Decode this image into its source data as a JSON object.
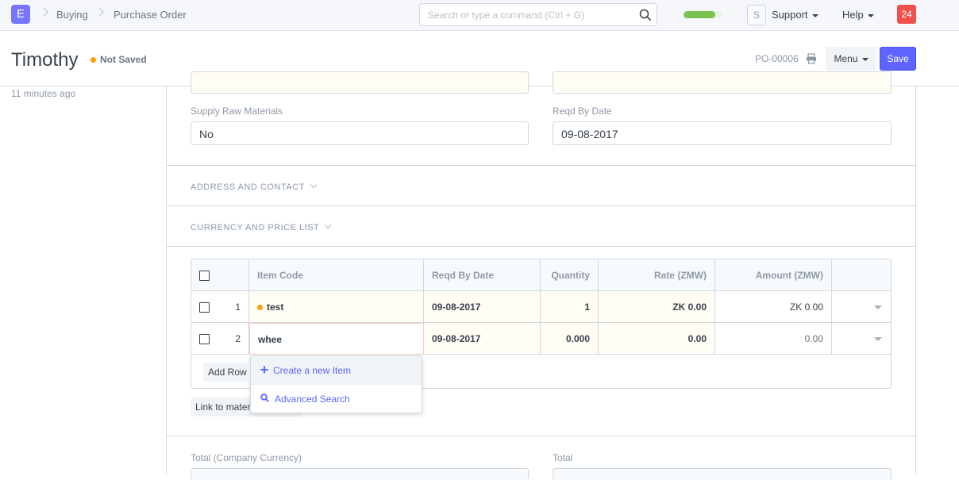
{
  "navbar": {
    "logo": "E",
    "breadcrumbs": [
      "Buying",
      "Purchase Order"
    ],
    "search_placeholder": "Search or type a command (Ctrl + G)",
    "progress_percent": 80,
    "avatar_initial": "S",
    "support_label": "Support",
    "help_label": "Help",
    "notification_count": "24"
  },
  "page": {
    "title": "Timothy",
    "status": "Not Saved",
    "doc_name": "PO-00006",
    "menu_label": "Menu",
    "save_label": "Save",
    "modified": "11 minutes ago"
  },
  "form": {
    "supply_raw_label": "Supply Raw Materials",
    "supply_raw_value": "No",
    "reqd_by_label": "Reqd By Date",
    "reqd_by_value": "09-08-2017",
    "section_address": "ADDRESS AND CONTACT",
    "section_currency": "CURRENCY AND PRICE LIST",
    "total_company_label": "Total (Company Currency)",
    "total_label": "Total"
  },
  "items_table": {
    "columns": [
      "Item Code",
      "Reqd By Date",
      "Quantity",
      "Rate (ZMW)",
      "Amount (ZMW)"
    ],
    "rows": [
      {
        "idx": "1",
        "item_code": "test",
        "reqd_by": "09-08-2017",
        "qty": "1",
        "rate": "ZK 0.00",
        "amount": "ZK 0.00"
      },
      {
        "idx": "2",
        "item_code": "whee",
        "reqd_by": "09-08-2017",
        "qty": "0.000",
        "rate": "0.00",
        "amount": "0.00"
      }
    ],
    "add_row_label": "Add Row",
    "link_label": "Link to material requests"
  },
  "dropdown": {
    "items": [
      {
        "icon": "plus-icon",
        "label": "Create a new Item"
      },
      {
        "icon": "search-icon",
        "label": "Advanced Search"
      }
    ]
  },
  "colors": {
    "primary": "#5e64ff",
    "indicator_orange": "#ffa00a",
    "notification_red": "#f0514d",
    "progress_green": "#7cc250"
  }
}
